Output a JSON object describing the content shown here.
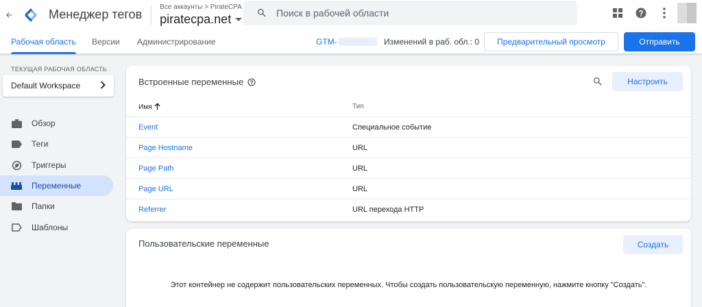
{
  "header": {
    "product_name": "Менеджер тегов",
    "account_path": "Все аккаунты > PirateCPA",
    "container_name": "piratecpa.net",
    "search_placeholder": "Поиск в рабочей области",
    "colors": {
      "blue": "#1a73e8",
      "logo_dark": "#1967d2",
      "logo_light": "#8ab4f8"
    }
  },
  "nav": {
    "tabs": [
      {
        "label": "Рабочая область",
        "active": true
      },
      {
        "label": "Версии",
        "active": false
      },
      {
        "label": "Администрирование",
        "active": false
      }
    ],
    "gtm_id_prefix": "GTM-",
    "changes_text": "Изменений в раб. обл.: 0",
    "preview_label": "Предварительный просмотр",
    "submit_label": "Отправить"
  },
  "sidebar": {
    "workspace_label": "Текущая рабочая область",
    "workspace_name": "Default Workspace",
    "items": [
      {
        "label": "Обзор",
        "icon": "briefcase-icon",
        "active": false
      },
      {
        "label": "Теги",
        "icon": "tag-icon",
        "active": false
      },
      {
        "label": "Триггеры",
        "icon": "trigger-icon",
        "active": false
      },
      {
        "label": "Переменные",
        "icon": "variables-icon",
        "active": true
      },
      {
        "label": "Папки",
        "icon": "folder-icon",
        "active": false
      },
      {
        "label": "Шаблоны",
        "icon": "template-icon",
        "active": false
      }
    ]
  },
  "builtin": {
    "title": "Встроенные переменные",
    "configure_label": "Настроить",
    "col_name": "Имя",
    "col_type": "Тип",
    "rows": [
      {
        "name": "Event",
        "type": "Специальное событие"
      },
      {
        "name": "Page Hostname",
        "type": "URL"
      },
      {
        "name": "Page Path",
        "type": "URL"
      },
      {
        "name": "Page URL",
        "type": "URL"
      },
      {
        "name": "Referrer",
        "type": "URL перехода HTTP"
      }
    ]
  },
  "user_vars": {
    "title": "Пользовательские переменные",
    "create_label": "Создать",
    "empty_message": "Этот контейнер не содержит пользовательских переменных. Чтобы создать пользовательскую переменную, нажмите кнопку \"Создать\"."
  }
}
